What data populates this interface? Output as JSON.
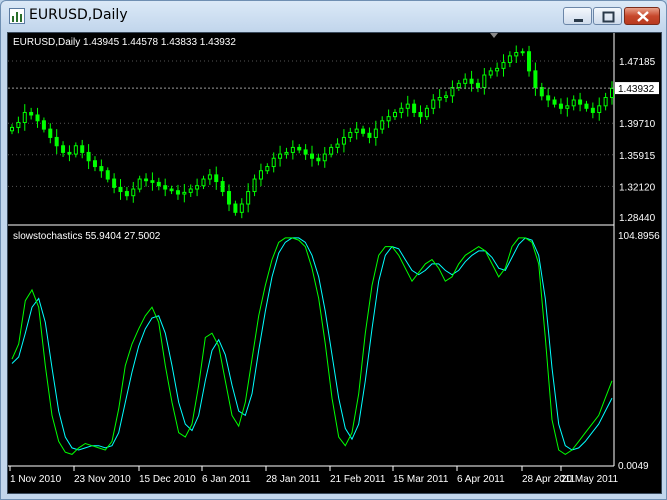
{
  "window": {
    "title": "EURUSD,Daily"
  },
  "price_panel": {
    "info": "EURUSD,Daily  1.43945 1.44578 1.43833 1.43932",
    "price_levels": [
      "1.47185",
      "1.43932",
      "1.39710",
      "1.35915",
      "1.32120",
      "1.28440"
    ],
    "current_price": "1.43932"
  },
  "indicator_panel": {
    "info": "slowstochastics 55.9404 27.5002",
    "scale_top": "104.8956",
    "scale_bottom": "0.0049"
  },
  "time_axis": {
    "labels": [
      "1 Nov 2010",
      "23 Nov 2010",
      "15 Dec 2010",
      "6 Jan 2011",
      "28 Jan 2011",
      "21 Feb 2011",
      "15 Mar 2011",
      "6 Apr 2011",
      "28 Apr 2011",
      "20 May 2011"
    ]
  },
  "colors": {
    "background": "#000000",
    "candles": "#00ff00",
    "main_line": "#00ff00",
    "signal_line": "#00ffff",
    "text": "#ffffff",
    "separator": "#ffffff"
  },
  "chart_data": [
    {
      "type": "line",
      "y_axis": [
        1.2844,
        1.47185
      ],
      "x_labels": [
        "1 Nov 2010",
        "23 Nov 2010",
        "15 Dec 2010",
        "6 Jan 2011",
        "28 Jan 2011",
        "21 Feb 2011",
        "15 Mar 2011",
        "6 Apr 2011",
        "28 Apr 2011",
        "20 May 2011"
      ],
      "series": [
        {
          "values": [
            1.392,
            1.398,
            1.41,
            1.407,
            1.4,
            1.39,
            1.38,
            1.37,
            1.362,
            1.36,
            1.37,
            1.362,
            1.352,
            1.345,
            1.34,
            1.33,
            1.32,
            1.315,
            1.31,
            1.318,
            1.33,
            1.328,
            1.326,
            1.322,
            1.318,
            1.316,
            1.312,
            1.314,
            1.318,
            1.322,
            1.33,
            1.335,
            1.327,
            1.315,
            1.3,
            1.29,
            1.3,
            1.315,
            1.33,
            1.34,
            1.345,
            1.355,
            1.36,
            1.362,
            1.368,
            1.365,
            1.36,
            1.355,
            1.352,
            1.36,
            1.368,
            1.372,
            1.38,
            1.386,
            1.39,
            1.385,
            1.38,
            1.39,
            1.4,
            1.405,
            1.41,
            1.415,
            1.42,
            1.41,
            1.405,
            1.415,
            1.425,
            1.428,
            1.43,
            1.44,
            1.445,
            1.45,
            1.445,
            1.44,
            1.455,
            1.46,
            1.463,
            1.47,
            1.478,
            1.482,
            1.483,
            1.46,
            1.44,
            1.43,
            1.425,
            1.42,
            1.415,
            1.418,
            1.425,
            1.42,
            1.415,
            1.41,
            1.418,
            1.428,
            1.439
          ]
        }
      ]
    },
    {
      "type": "line",
      "y_axis": [
        0.0049,
        104.8956
      ],
      "x_labels": [
        "1 Nov 2010",
        "23 Nov 2010",
        "15 Dec 2010",
        "6 Jan 2011",
        "28 Jan 2011",
        "21 Feb 2011",
        "15 Mar 2011",
        "6 Apr 2011",
        "28 Apr 2011",
        "20 May 2011"
      ],
      "series": [
        {
          "values": [
            48,
            55,
            75,
            80,
            72,
            45,
            22,
            10,
            5,
            4,
            7,
            9,
            8,
            7,
            6,
            10,
            25,
            45,
            55,
            62,
            68,
            72,
            65,
            45,
            28,
            14,
            12,
            18,
            36,
            58,
            60,
            54,
            38,
            22,
            17,
            28,
            48,
            68,
            82,
            94,
            102,
            104,
            104,
            103,
            100,
            90,
            76,
            55,
            30,
            12,
            8,
            14,
            32,
            60,
            82,
            96,
            100,
            100,
            96,
            90,
            84,
            88,
            92,
            94,
            90,
            84,
            86,
            92,
            96,
            98,
            100,
            98,
            92,
            86,
            90,
            100,
            104,
            104,
            102,
            92,
            58,
            20,
            6,
            4,
            6,
            10,
            14,
            18,
            22,
            30,
            38
          ]
        },
        {
          "values": [
            46,
            49,
            60,
            72,
            76,
            65,
            44,
            24,
            12,
            7,
            6,
            7,
            8,
            8,
            7,
            8,
            14,
            28,
            42,
            54,
            62,
            67,
            68,
            60,
            45,
            28,
            18,
            15,
            22,
            38,
            52,
            57,
            50,
            36,
            24,
            22,
            32,
            52,
            70,
            86,
            97,
            102,
            104,
            104,
            102,
            96,
            86,
            70,
            50,
            30,
            16,
            11,
            18,
            38,
            62,
            84,
            96,
            100,
            99,
            94,
            89,
            87,
            89,
            92,
            92,
            89,
            87,
            89,
            93,
            96,
            98,
            98,
            95,
            90,
            89,
            95,
            101,
            104,
            103,
            96,
            76,
            44,
            18,
            8,
            6,
            7,
            10,
            14,
            18,
            24,
            30
          ]
        }
      ]
    }
  ]
}
